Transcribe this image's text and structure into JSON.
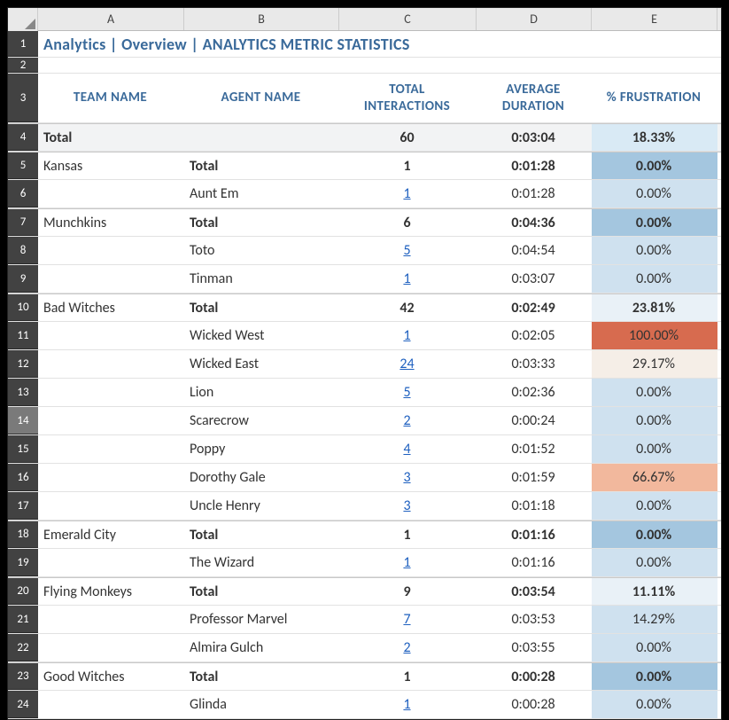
{
  "columns": {
    "A": "A",
    "B": "B",
    "C": "C",
    "D": "D",
    "E": "E"
  },
  "row_labels": [
    "1",
    "2",
    "3",
    "4",
    "5",
    "6",
    "7",
    "8",
    "9",
    "10",
    "11",
    "12",
    "13",
    "14",
    "15",
    "16",
    "17",
    "18",
    "19",
    "20",
    "21",
    "22",
    "23",
    "24"
  ],
  "title": "Analytics | Overview | ANALYTICS METRIC STATISTICS",
  "headers": {
    "team": "TEAM NAME",
    "agent": "AGENT NAME",
    "interactions": "TOTAL INTERACTIONS",
    "duration": "AVERAGE DURATION",
    "frustration": "% FRUSTRATION"
  },
  "grand_total": {
    "label": "Total",
    "interactions": "60",
    "duration": "0:03:04",
    "frustration": "18.33%"
  },
  "rows": [
    {
      "type": "team",
      "team": "Kansas",
      "agent": "Total",
      "interactions": "1",
      "duration": "0:01:28",
      "frustration": "0.00%",
      "tint": "tint-deep"
    },
    {
      "type": "agent",
      "team": "",
      "agent": "Aunt Em",
      "interactions": "1",
      "duration": "0:01:28",
      "frustration": "0.00%",
      "tint": "tint-low",
      "link": true
    },
    {
      "type": "team",
      "team": "Munchkins",
      "agent": "Total",
      "interactions": "6",
      "duration": "0:04:36",
      "frustration": "0.00%",
      "tint": "tint-deep"
    },
    {
      "type": "agent",
      "team": "",
      "agent": "Toto",
      "interactions": "5",
      "duration": "0:04:54",
      "frustration": "0.00%",
      "tint": "tint-low",
      "link": true
    },
    {
      "type": "agent",
      "team": "",
      "agent": "Tinman",
      "interactions": "1",
      "duration": "0:03:07",
      "frustration": "0.00%",
      "tint": "tint-low",
      "link": true
    },
    {
      "type": "team",
      "team": "Bad Witches",
      "agent": "Total",
      "interactions": "42",
      "duration": "0:02:49",
      "frustration": "23.81%",
      "tint": "tint-pale"
    },
    {
      "type": "agent",
      "team": "",
      "agent": "Wicked West",
      "interactions": "1",
      "duration": "0:02:05",
      "frustration": "100.00%",
      "tint": "tint-red",
      "link": true
    },
    {
      "type": "agent",
      "team": "",
      "agent": "Wicked East",
      "interactions": "24",
      "duration": "0:03:33",
      "frustration": "29.17%",
      "tint": "tint-beige",
      "link": true
    },
    {
      "type": "agent",
      "team": "",
      "agent": "Lion",
      "interactions": "5",
      "duration": "0:02:36",
      "frustration": "0.00%",
      "tint": "tint-low",
      "link": true
    },
    {
      "type": "agent",
      "team": "",
      "agent": "Scarecrow",
      "interactions": "2",
      "duration": "0:00:24",
      "frustration": "0.00%",
      "tint": "tint-low",
      "link": true
    },
    {
      "type": "agent",
      "team": "",
      "agent": "Poppy",
      "interactions": "4",
      "duration": "0:01:52",
      "frustration": "0.00%",
      "tint": "tint-low",
      "link": true
    },
    {
      "type": "agent",
      "team": "",
      "agent": "Dorothy Gale",
      "interactions": "3",
      "duration": "0:01:59",
      "frustration": "66.67%",
      "tint": "tint-salmon",
      "link": true
    },
    {
      "type": "agent",
      "team": "",
      "agent": "Uncle Henry",
      "interactions": "3",
      "duration": "0:01:18",
      "frustration": "0.00%",
      "tint": "tint-low",
      "link": true
    },
    {
      "type": "team",
      "team": "Emerald City",
      "agent": "Total",
      "interactions": "1",
      "duration": "0:01:16",
      "frustration": "0.00%",
      "tint": "tint-deep"
    },
    {
      "type": "agent",
      "team": "",
      "agent": "The Wizard",
      "interactions": "1",
      "duration": "0:01:16",
      "frustration": "0.00%",
      "tint": "tint-low",
      "link": true
    },
    {
      "type": "team",
      "team": "Flying Monkeys",
      "agent": "Total",
      "interactions": "9",
      "duration": "0:03:54",
      "frustration": "11.11%",
      "tint": "tint-pale"
    },
    {
      "type": "agent",
      "team": "",
      "agent": "Professor Marvel",
      "interactions": "7",
      "duration": "0:03:53",
      "frustration": "14.29%",
      "tint": "tint-low",
      "link": true
    },
    {
      "type": "agent",
      "team": "",
      "agent": "Almira Gulch",
      "interactions": "2",
      "duration": "0:03:55",
      "frustration": "0.00%",
      "tint": "tint-low",
      "link": true
    },
    {
      "type": "team",
      "team": "Good Witches",
      "agent": "Total",
      "interactions": "1",
      "duration": "0:00:28",
      "frustration": "0.00%",
      "tint": "tint-deep"
    },
    {
      "type": "agent",
      "team": "",
      "agent": "Glinda",
      "interactions": "1",
      "duration": "0:00:28",
      "frustration": "0.00%",
      "tint": "tint-low",
      "link": true
    }
  ],
  "selected_row_index": "14"
}
